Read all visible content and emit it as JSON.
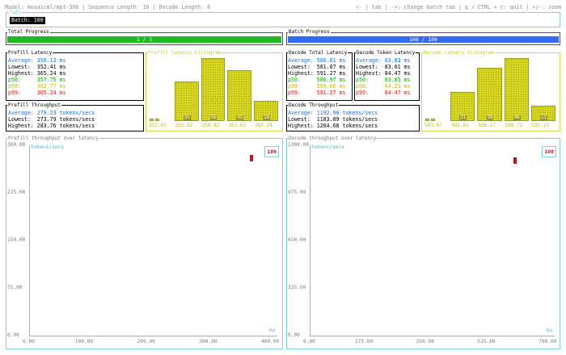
{
  "header": {
    "left": "Model: mosaicml/mpt-30b | Sequence Length: 10 | Decode Length: 6",
    "right": "<- | tab | ->: change batch tab | q / CTRL + c: quit | +/-: zoom"
  },
  "tabs": {
    "title": "Tabs",
    "active": "Batch: 100"
  },
  "total_progress": {
    "title": "Total Progress",
    "value": "1 / 1",
    "fraction": 1.0,
    "color": "#1fb81f"
  },
  "batch_progress": {
    "title": "Batch Progress",
    "value": "100 / 100",
    "fraction": 1.0,
    "color": "#2e6cf2"
  },
  "prefill_latency": {
    "title": "Prefill Latency",
    "average": "Average: 358.13 ms",
    "lowest": "Lowest:  352.41 ms",
    "highest": "Highest: 365.24 ms",
    "p50": "p50:     357.75 ms",
    "p90": "p90:     362.77 ms",
    "p99": "p99:     365.24 ms"
  },
  "prefill_histogram": {
    "title": "Prefill latency histogram",
    "bars": [
      {
        "label": "352.41",
        "value": 2,
        "count": "1"
      },
      {
        "label": "355.62",
        "value": 35,
        "count": "35"
      },
      {
        "label": "358.82",
        "value": 56,
        "count": "56"
      },
      {
        "label": "362.03",
        "value": 45,
        "count": "45"
      },
      {
        "label": "365.24",
        "value": 18,
        "count": "18"
      }
    ],
    "max": 56
  },
  "prefill_throughput": {
    "title": "Prefill Throughput",
    "average": "Average: 279.23 tokens/secs",
    "lowest": "Lowest:  273.79 tokens/secs",
    "highest": "Highest: 283.76 tokens/secs"
  },
  "decode_total_latency": {
    "title": "Decode Total Latency",
    "average": "Average: 586.81 ms",
    "lowest": "Lowest:  581.07 ms",
    "highest": "Highest: 591.27 ms",
    "p50": "p50:     586.97 ms",
    "p90": "p90:     589.60 ms",
    "p99": "p99:     591.27 ms"
  },
  "decode_token_latency": {
    "title": "Decode Token Latency",
    "average": "Average: 83.83 ms",
    "lowest": "Lowest:  83.01 ms",
    "highest": "Highest: 84.47 ms",
    "p50": "p50:     83.85 ms",
    "p90": "p90:     84.23 ms",
    "p99": "p99:     84.47 ms"
  },
  "decode_histogram": {
    "title": "Decode latency histogram",
    "bars": [
      {
        "label": "581.07",
        "value": 2,
        "count": "1"
      },
      {
        "label": "583.62",
        "value": 21,
        "count": "21"
      },
      {
        "label": "586.17",
        "value": 39,
        "count": "39"
      },
      {
        "label": "588.72",
        "value": 46,
        "count": "46"
      },
      {
        "label": "591.27",
        "value": 11,
        "count": "11"
      }
    ],
    "max": 46
  },
  "decode_throughput": {
    "title": "Decode Throughput",
    "average": "Average: 1192.90 tokens/secs",
    "lowest": "Lowest:  1183.89 tokens/secs",
    "highest": "Highest: 1204.68 tokens/secs"
  },
  "chart_data": [
    {
      "type": "scatter",
      "title": "Prefill throughput over latency",
      "ylabel": "tokens/secs",
      "xlabel": "ms",
      "legend": "100",
      "xlim": [
        0,
        400
      ],
      "ylim": [
        0,
        300
      ],
      "x_ticks": [
        "0.00",
        "100.00",
        "200.00",
        "300.00",
        "400.00"
      ],
      "y_ticks": [
        "300.00",
        "225.00",
        "150.00",
        "75.00",
        "0.00"
      ],
      "points": [
        {
          "x": 358.1,
          "y": 279.2
        }
      ],
      "color": "#c0141e"
    },
    {
      "type": "scatter",
      "title": "Decode throughput over latency",
      "ylabel": "tokens/secs",
      "xlabel": "ms",
      "legend": "100",
      "xlim": [
        0,
        700
      ],
      "ylim": [
        0,
        1300
      ],
      "x_ticks": [
        "0.00",
        "175.00",
        "350.00",
        "525.00",
        "700.00"
      ],
      "y_ticks": [
        "1300.00",
        "975.00",
        "650.00",
        "325.00",
        "0.00"
      ],
      "points": [
        {
          "x": 586.8,
          "y": 1192.9
        }
      ],
      "color": "#c0141e"
    }
  ]
}
